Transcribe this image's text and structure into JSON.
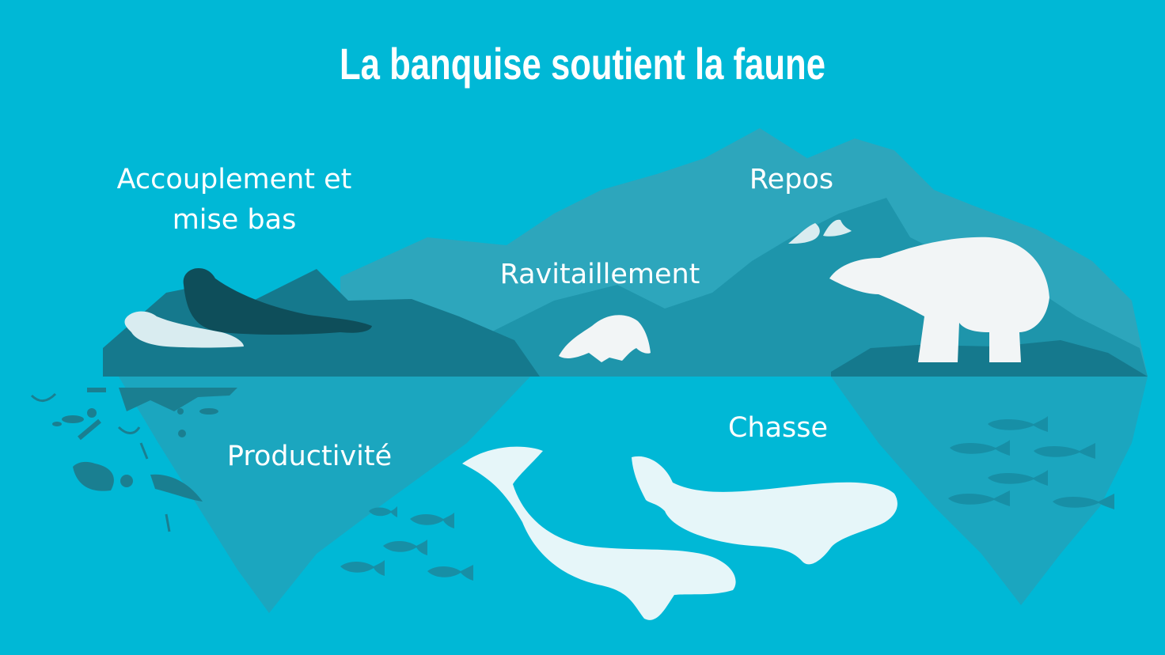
{
  "title": "La banquise soutient la faune",
  "labels": {
    "mating": "Accouplement et mise bas",
    "rest": "Repos",
    "feeding": "Ravitaillement",
    "productivity": "Productivité",
    "hunting": "Chasse"
  },
  "colors": {
    "ocean": "#00b8d6",
    "ice_far": "#2da6bc",
    "ice_mid": "#1e95ab",
    "ice_near": "#15798d",
    "ice_underwater": "#1ba6bf",
    "seal_dark": "#0e4e5a",
    "white_animal": "#f2f5f6"
  },
  "icons": [
    "walrus-seal",
    "seal-pup",
    "arctic-fox",
    "polar-bear",
    "seabirds",
    "beluga-whale",
    "arctic-cod",
    "zooplankton"
  ]
}
